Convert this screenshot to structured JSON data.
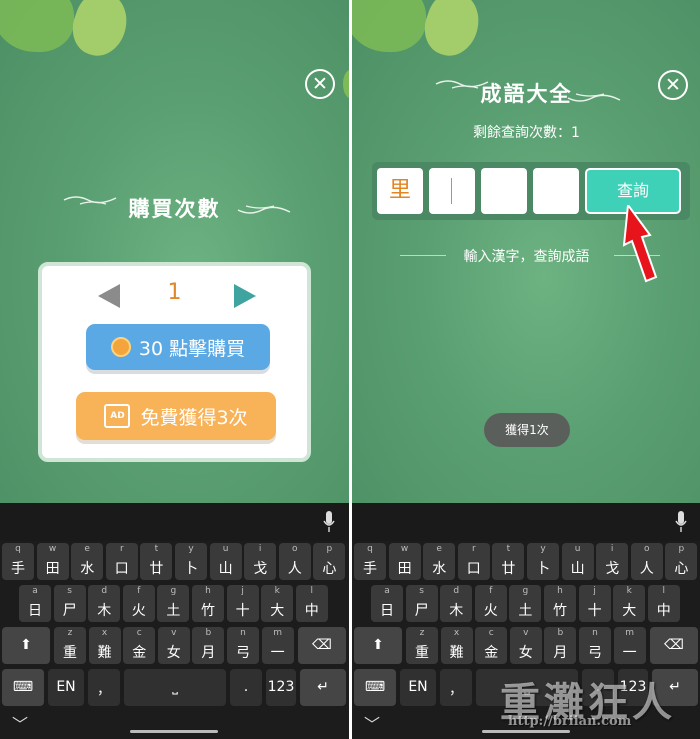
{
  "left": {
    "title": "購買次數",
    "count": "1",
    "buy_button_label": "30  點擊購買",
    "ad_button_label": "免費獲得3次",
    "ad_icon_text": "AD",
    "close_icon": "close-icon"
  },
  "right": {
    "title": "成語大全",
    "remaining_label": "剩餘查詢次數：1",
    "char_boxes": [
      "里",
      "",
      "",
      ""
    ],
    "query_button_label": "查詢",
    "hint": "輸入漢字，查詢成語",
    "toast": "獲得1次"
  },
  "keyboard": {
    "row1": [
      {
        "sub": "q",
        "main": "手"
      },
      {
        "sub": "w",
        "main": "田"
      },
      {
        "sub": "e",
        "main": "水"
      },
      {
        "sub": "r",
        "main": "口"
      },
      {
        "sub": "t",
        "main": "廿"
      },
      {
        "sub": "y",
        "main": "卜"
      },
      {
        "sub": "u",
        "main": "山"
      },
      {
        "sub": "i",
        "main": "戈"
      },
      {
        "sub": "o",
        "main": "人"
      },
      {
        "sub": "p",
        "main": "心"
      }
    ],
    "row2": [
      {
        "sub": "a",
        "main": "日"
      },
      {
        "sub": "s",
        "main": "尸"
      },
      {
        "sub": "d",
        "main": "木"
      },
      {
        "sub": "f",
        "main": "火"
      },
      {
        "sub": "g",
        "main": "土"
      },
      {
        "sub": "h",
        "main": "竹"
      },
      {
        "sub": "j",
        "main": "十"
      },
      {
        "sub": "k",
        "main": "大"
      },
      {
        "sub": "l",
        "main": "中"
      }
    ],
    "row3": [
      {
        "sub": "z",
        "main": "重"
      },
      {
        "sub": "x",
        "main": "難"
      },
      {
        "sub": "c",
        "main": "金"
      },
      {
        "sub": "v",
        "main": "女"
      },
      {
        "sub": "b",
        "main": "月"
      },
      {
        "sub": "n",
        "main": "弓"
      },
      {
        "sub": "m",
        "main": "一"
      }
    ],
    "lang_key": "EN",
    "comma_key": "，",
    "period_key": ".",
    "num_key": "123"
  },
  "watermark": {
    "text": "重灘狂人",
    "url": "http://briian.com"
  },
  "colors": {
    "bg_green": "#5a9f72",
    "buy_blue": "#5aa9e4",
    "ad_orange": "#f8b257",
    "query_teal": "#3fd0b8",
    "count_orange": "#e0892b",
    "arrow_red": "#e8141c"
  }
}
